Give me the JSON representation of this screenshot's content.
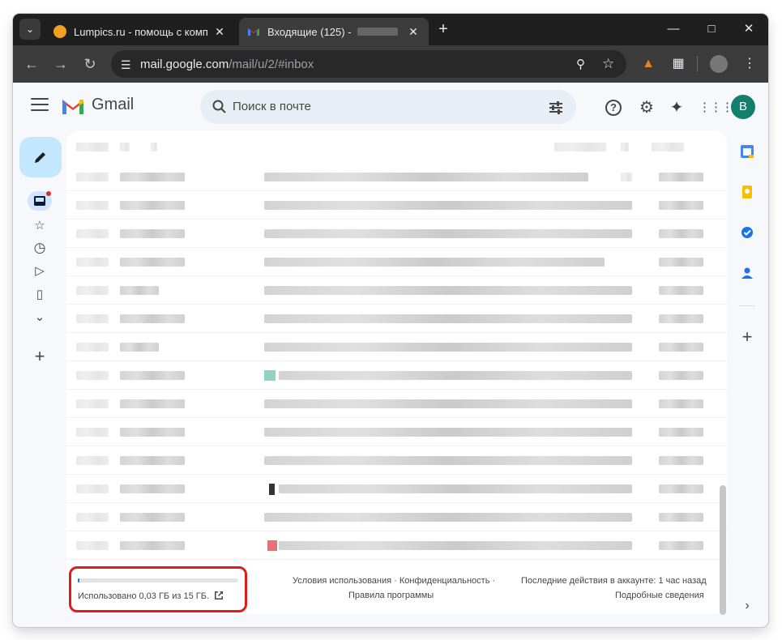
{
  "browser": {
    "tabs": [
      {
        "title": "Lumpics.ru - помощь с компьк",
        "active": false
      },
      {
        "title": "Входящие (125) -",
        "active": true
      }
    ],
    "url_host": "mail.google.com",
    "url_path": "/mail/u/2/#inbox"
  },
  "gmail": {
    "app_name": "Gmail",
    "search_placeholder": "Поиск в почте",
    "avatar_letter": "В"
  },
  "footer": {
    "storage_text": "Использовано 0,03 ГБ из 15 ГБ.",
    "storage_used_fraction": 0.002,
    "terms": "Условия использования · Конфиденциальность ·",
    "program_policies": "Правила программы",
    "last_activity": "Последние действия в аккаунте: 1 час назад",
    "details": "Подробные сведения"
  },
  "colors": {
    "brand_red": "#ea4335",
    "compose_bg": "#c2e7ff",
    "avatar_bg": "#12806d",
    "highlight": "#e21b1b"
  }
}
